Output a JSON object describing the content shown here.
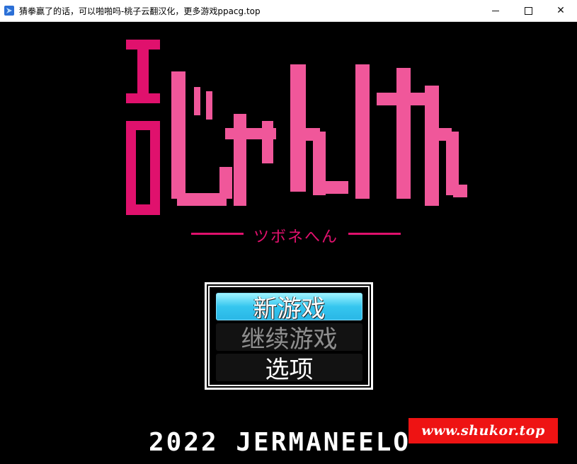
{
  "window": {
    "title": "猜拳赢了的话，可以啪啪吗-桃子云翻汉化，更多游戏ppacg.top",
    "minimize_icon": "minimize-icon",
    "maximize_icon": "maximize-icon",
    "close_icon": "close-icon",
    "close_label": "✕"
  },
  "game": {
    "logo_text": "エロじゃんけん",
    "subtitle": "ツボネへん",
    "menu": {
      "items": [
        {
          "label": "新游戏",
          "state": "selected"
        },
        {
          "label": "继续游戏",
          "state": "disabled"
        },
        {
          "label": "选项",
          "state": "normal"
        }
      ]
    },
    "copyright": "2022 JERMANEELO",
    "colors": {
      "logo_pink": "#f0579a",
      "logo_red": "#e0116d",
      "menu_highlight": "#35c6ef",
      "watermark_bg": "#ee1313"
    }
  },
  "watermark": {
    "text": "www.shukor.top"
  }
}
